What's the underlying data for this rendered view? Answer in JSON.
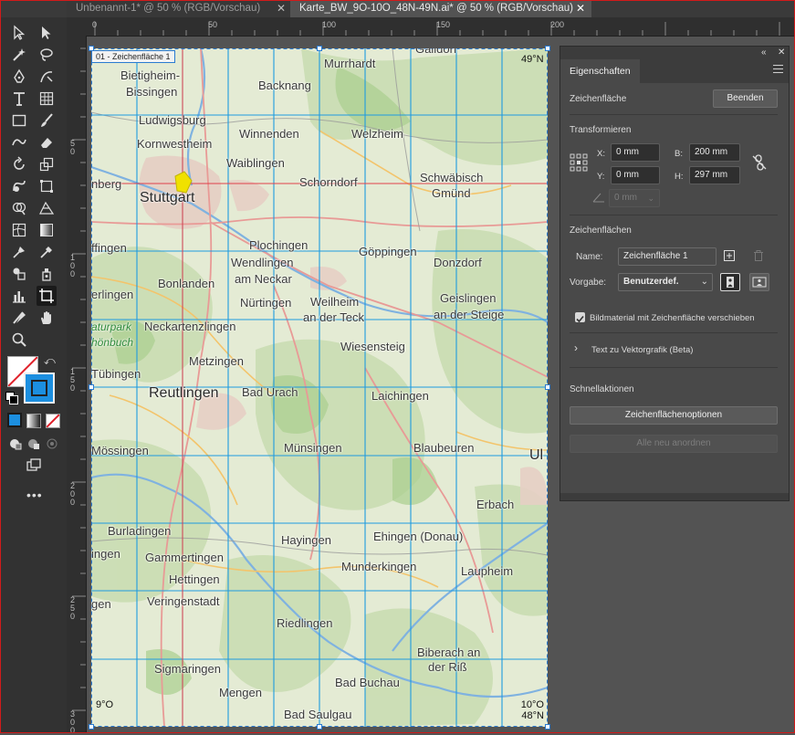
{
  "tabs": [
    {
      "label": "Unbenannt-1* @ 50 % (RGB/Vorschau)",
      "active": false
    },
    {
      "label": "Karte_BW_9O-10O_48N-49N.ai* @ 50 % (RGB/Vorschau)",
      "active": true
    }
  ],
  "tab_close_glyph": "✕",
  "ruler": {
    "horizontal": [
      "0",
      "50",
      "100",
      "150",
      "200"
    ],
    "vertical": [
      "50",
      "100",
      "150",
      "200",
      "250",
      "300"
    ]
  },
  "artboard": {
    "tag": "01 - Zeichenfläche 1",
    "corners": {
      "top_right": "49°N",
      "bottom_left": "9°O",
      "bottom_right_1": "10°O",
      "bottom_right_2": "48°N"
    }
  },
  "map_towns": [
    {
      "name": "Gaildorf"
    },
    {
      "name": "Murrhardt"
    },
    {
      "name": "Bietigheim-"
    },
    {
      "name": "Bissingen"
    },
    {
      "name": "Backnang"
    },
    {
      "name": "Ludwigsburg"
    },
    {
      "name": "Winnenden"
    },
    {
      "name": "Welzheim"
    },
    {
      "name": "Kornwestheim"
    },
    {
      "name": "Waiblingen"
    },
    {
      "name": "Schwäbisch"
    },
    {
      "name": "Gmünd"
    },
    {
      "name": "Schorndorf"
    },
    {
      "name": "nberg"
    },
    {
      "name": "Stuttgart"
    },
    {
      "name": "Plochingen"
    },
    {
      "name": "Göppingen"
    },
    {
      "name": "ffingen"
    },
    {
      "name": "Wendlingen"
    },
    {
      "name": "am Neckar"
    },
    {
      "name": "Donzdorf"
    },
    {
      "name": "Bonlanden"
    },
    {
      "name": "Nürtingen"
    },
    {
      "name": "Weilheim"
    },
    {
      "name": "an der Teck"
    },
    {
      "name": "Geislingen"
    },
    {
      "name": "an der Steige"
    },
    {
      "name": "erlingen"
    },
    {
      "name": "aturpark"
    },
    {
      "name": "hönbuch"
    },
    {
      "name": "Neckartenzlingen"
    },
    {
      "name": "Wiesensteig"
    },
    {
      "name": "Metzingen"
    },
    {
      "name": "Tübingen"
    },
    {
      "name": "Reutlingen"
    },
    {
      "name": "Bad Urach"
    },
    {
      "name": "Laichingen"
    },
    {
      "name": "Mössingen"
    },
    {
      "name": "Münsingen"
    },
    {
      "name": "Blaubeuren"
    },
    {
      "name": "Ul"
    },
    {
      "name": "Erbach"
    },
    {
      "name": "Burladingen"
    },
    {
      "name": "Hayingen"
    },
    {
      "name": "Ehingen (Donau)"
    },
    {
      "name": "ingen"
    },
    {
      "name": "Gammertingen"
    },
    {
      "name": "Munderkingen"
    },
    {
      "name": "Laupheim"
    },
    {
      "name": "Hettingen"
    },
    {
      "name": "Veringenstadt"
    },
    {
      "name": "gen"
    },
    {
      "name": "Riedlingen"
    },
    {
      "name": "Biberach an"
    },
    {
      "name": "der Riß"
    },
    {
      "name": "Sigmaringen"
    },
    {
      "name": "Bad Buchau"
    },
    {
      "name": "Mengen"
    },
    {
      "name": "Bad Saulgau"
    }
  ],
  "panel": {
    "controls": {
      "collapse": "«",
      "close": "✕"
    },
    "tab": "Eigenschaften",
    "section_artboard": "Zeichenfläche",
    "end_button": "Beenden",
    "transform_title": "Transformieren",
    "x_label": "X:",
    "x_value": "0 mm",
    "y_label": "Y:",
    "y_value": "0 mm",
    "w_label": "B:",
    "w_value": "200 mm",
    "h_label": "H:",
    "h_value": "297 mm",
    "angle_value": "0 mm",
    "artboards_title": "Zeichenflächen",
    "name_label": "Name:",
    "name_value": "Zeichenfläche 1",
    "preset_label": "Vorgabe:",
    "preset_value": "Benutzerdef.",
    "move_artwork_label": "Bildmaterial mit Zeichenfläche verschieben",
    "move_artwork_checked": true,
    "text_to_vector": "Text zu Vektorgrafik (Beta)",
    "quick_actions_title": "Schnellaktionen",
    "artboard_options_button": "Zeichenflächenoptionen",
    "rearrange_all_button": "Alle neu anordnen"
  },
  "colors": {
    "accent": "#2a7bd1",
    "grid": "#1e9be0",
    "panel_bg": "#494949",
    "app_bg": "#535353",
    "window_border": "#d21a1a"
  }
}
